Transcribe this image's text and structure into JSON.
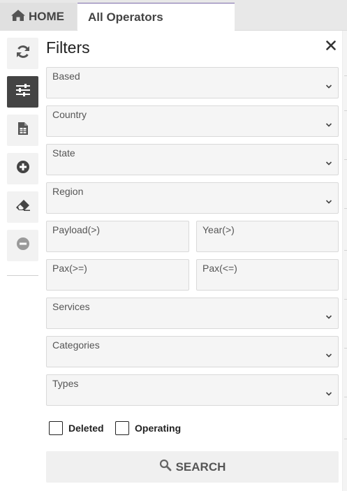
{
  "tabs": {
    "home_label": "HOME",
    "active_label": "All Operators"
  },
  "panel": {
    "title": "Filters"
  },
  "toolbar": [
    {
      "icon": "refresh-icon"
    },
    {
      "icon": "sliders-icon",
      "active": true
    },
    {
      "icon": "spreadsheet-icon"
    },
    {
      "icon": "plus-circle-icon"
    },
    {
      "icon": "eraser-icon"
    },
    {
      "icon": "minus-circle-icon",
      "disabled": true
    }
  ],
  "filters": {
    "based": "Based",
    "country": "Country",
    "state": "State",
    "region": "Region",
    "payload": "Payload(>)",
    "year": "Year(>)",
    "pax_min": "Pax(>=)",
    "pax_max": "Pax(<=)",
    "services": "Services",
    "categories": "Categories",
    "types": "Types"
  },
  "checkboxes": {
    "deleted": "Deleted",
    "operating": "Operating"
  },
  "search_label": "SEARCH",
  "colors": {
    "accent_border": "#7a6aa8",
    "active_tool": "#444444",
    "field_bg": "#f5f5f5"
  }
}
